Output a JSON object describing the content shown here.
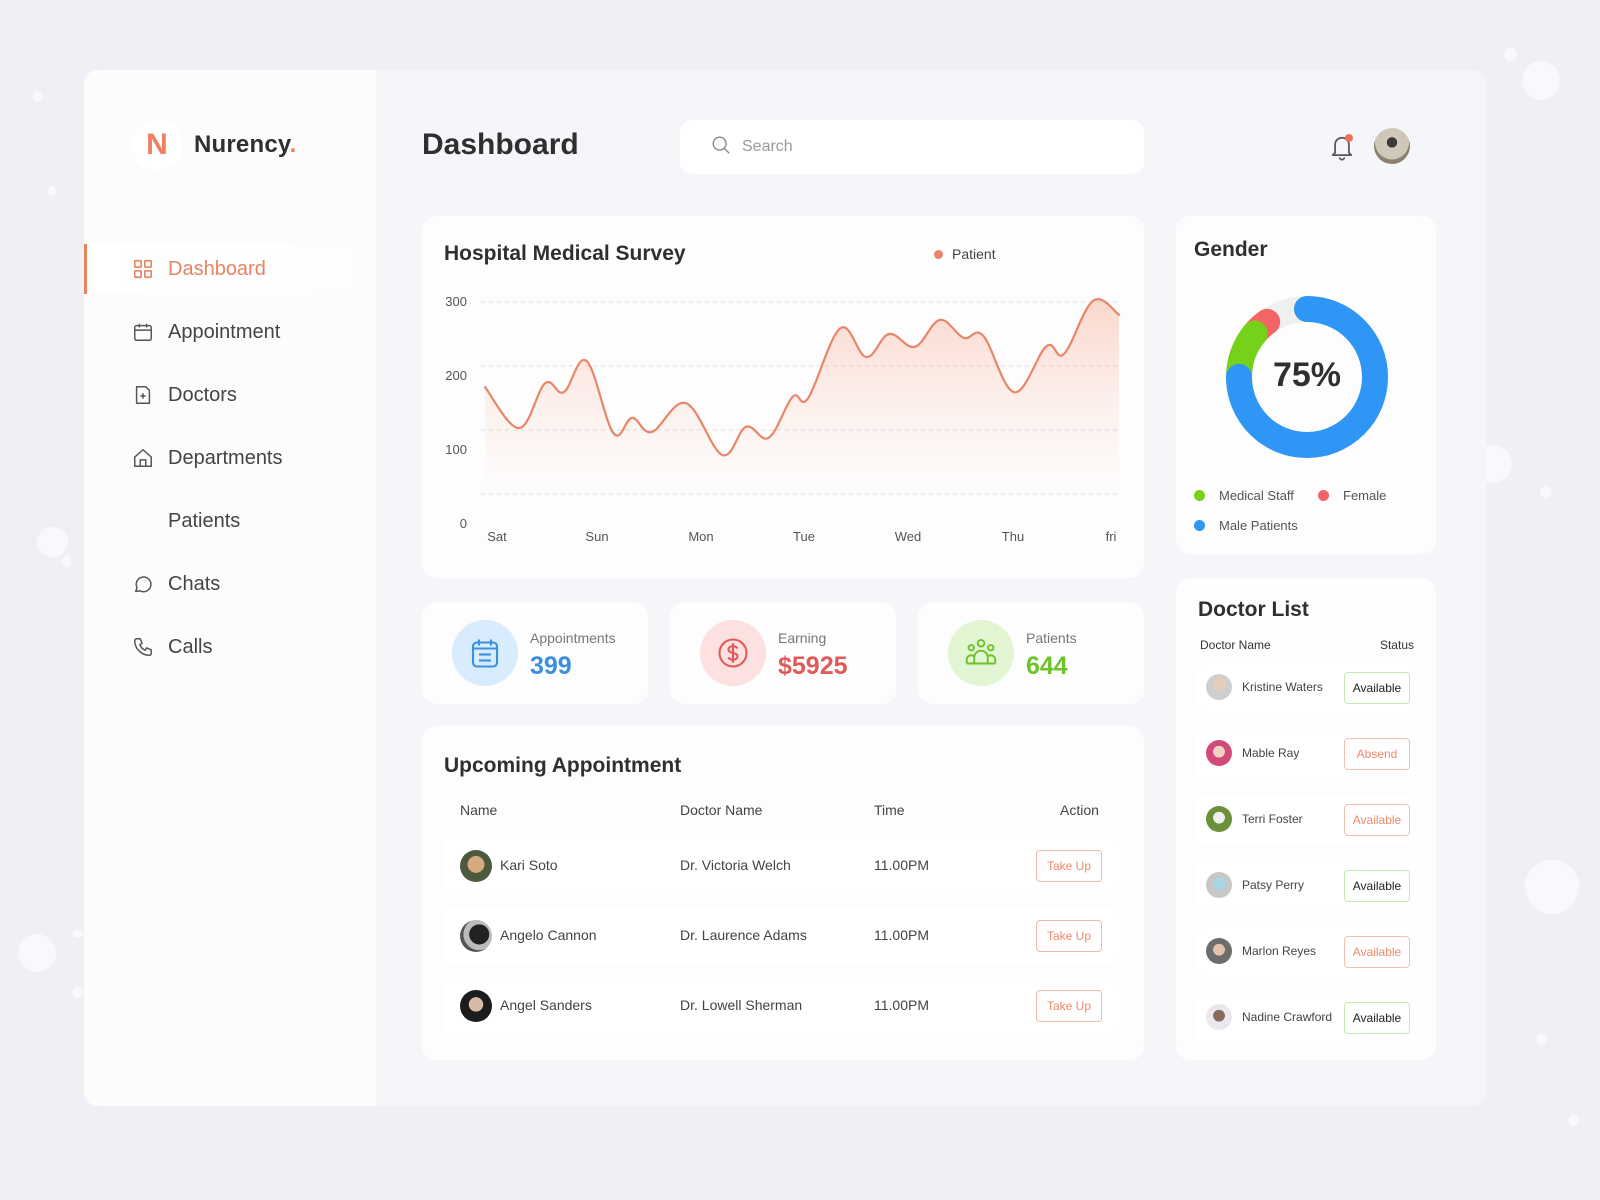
{
  "app": {
    "name": "Nurency",
    "name_dot": ".",
    "logo_letter": "N"
  },
  "sidebar": {
    "items": [
      {
        "label": "Dashboard",
        "icon": "grid-icon",
        "active": true
      },
      {
        "label": "Appointment",
        "icon": "calendar-icon",
        "active": false
      },
      {
        "label": "Doctors",
        "icon": "file-plus-icon",
        "active": false
      },
      {
        "label": "Departments",
        "icon": "home-icon",
        "active": false
      },
      {
        "label": "Patients",
        "icon": "",
        "active": false
      },
      {
        "label": "Chats",
        "icon": "chat-bubble-icon",
        "active": false
      },
      {
        "label": "Calls",
        "icon": "phone-icon",
        "active": false
      }
    ]
  },
  "header": {
    "title": "Dashboard",
    "search": {
      "placeholder": "Search",
      "value": ""
    },
    "notifications": {
      "has_unread": true
    }
  },
  "survey": {
    "title": "Hospital Medical Survey",
    "legend": "Patient"
  },
  "chart_data": {
    "type": "area",
    "title": "Hospital Medical Survey",
    "xlabel": "",
    "ylabel": "",
    "categories": [
      "Sat",
      "Sun",
      "Mon",
      "Tue",
      "Wed",
      "Thu",
      "fri"
    ],
    "y_ticks": [
      0,
      100,
      200,
      300
    ],
    "ylim": [
      0,
      300
    ],
    "grid": true,
    "legend_position": "top-right",
    "series": [
      {
        "name": "Patient",
        "color": "#e8866a",
        "x": [
          0,
          0.33,
          0.58,
          0.76,
          0.98,
          1.24,
          1.42,
          1.61,
          1.94,
          2.29,
          2.52,
          2.74,
          2.97,
          3.12,
          3.43,
          3.68,
          3.9,
          4.15,
          4.39,
          4.62,
          4.81,
          5.11,
          5.42,
          5.59,
          5.87,
          6.12
        ],
        "values": [
          167,
          103,
          173,
          159,
          208,
          95,
          119,
          97,
          142,
          61,
          105,
          88,
          152,
          150,
          259,
          214,
          250,
          230,
          272,
          244,
          247,
          159,
          231,
          219,
          302,
          280
        ]
      }
    ]
  },
  "stats": [
    {
      "label": "Appointments",
      "value": "399",
      "icon": "calendar-icon",
      "color": "#3a8fe0",
      "bg": "#d9ecfd"
    },
    {
      "label": "Earning",
      "value": "$5925",
      "icon": "dollar-icon",
      "color": "#e05a5a",
      "bg": "#fde0e0"
    },
    {
      "label": "Patients",
      "value": "644",
      "icon": "people-icon",
      "color": "#6cc42a",
      "bg": "#e2f6d3"
    }
  ],
  "upcoming": {
    "title": "Upcoming Appointment",
    "columns": [
      "Name",
      "Doctor Name",
      "Time",
      "Action"
    ],
    "rows": [
      {
        "name": "Kari Soto",
        "doctor": "Dr. Victoria Welch",
        "time": "11.00PM",
        "action": "Take Up"
      },
      {
        "name": "Angelo Cannon",
        "doctor": "Dr. Laurence Adams",
        "time": "11.00PM",
        "action": "Take Up"
      },
      {
        "name": "Angel Sanders",
        "doctor": "Dr. Lowell Sherman",
        "time": "11.00PM",
        "action": "Take Up"
      }
    ]
  },
  "gender": {
    "title": "Gender",
    "center_label": "75%",
    "segments": [
      {
        "name": "Male Patients",
        "percent": 75,
        "color": "#2f96f5"
      },
      {
        "name": "Medical Staff",
        "percent": 11,
        "color": "#76d11a"
      },
      {
        "name": "Female",
        "percent": 4,
        "color": "#f26565"
      }
    ],
    "track_color": "#f0f0f0",
    "legend": [
      {
        "name": "Medical Staff",
        "color": "#76d11a"
      },
      {
        "name": "Female",
        "color": "#f26565"
      },
      {
        "name": "Male Patients",
        "color": "#2f96f5"
      }
    ]
  },
  "doctor_list": {
    "title": "Doctor List",
    "columns": [
      "Doctor Name",
      "Status"
    ],
    "rows": [
      {
        "name": "Kristine Waters",
        "status": "Available",
        "style": "green"
      },
      {
        "name": "Mable Ray",
        "status": "Absend",
        "style": "orange"
      },
      {
        "name": "Terri Foster",
        "status": "Available",
        "style": "orange"
      },
      {
        "name": "Patsy Perry",
        "status": "Available",
        "style": "green"
      },
      {
        "name": "Marlon Reyes",
        "status": "Available",
        "style": "orange"
      },
      {
        "name": "Nadine Crawford",
        "status": "Available",
        "style": "green"
      }
    ]
  }
}
